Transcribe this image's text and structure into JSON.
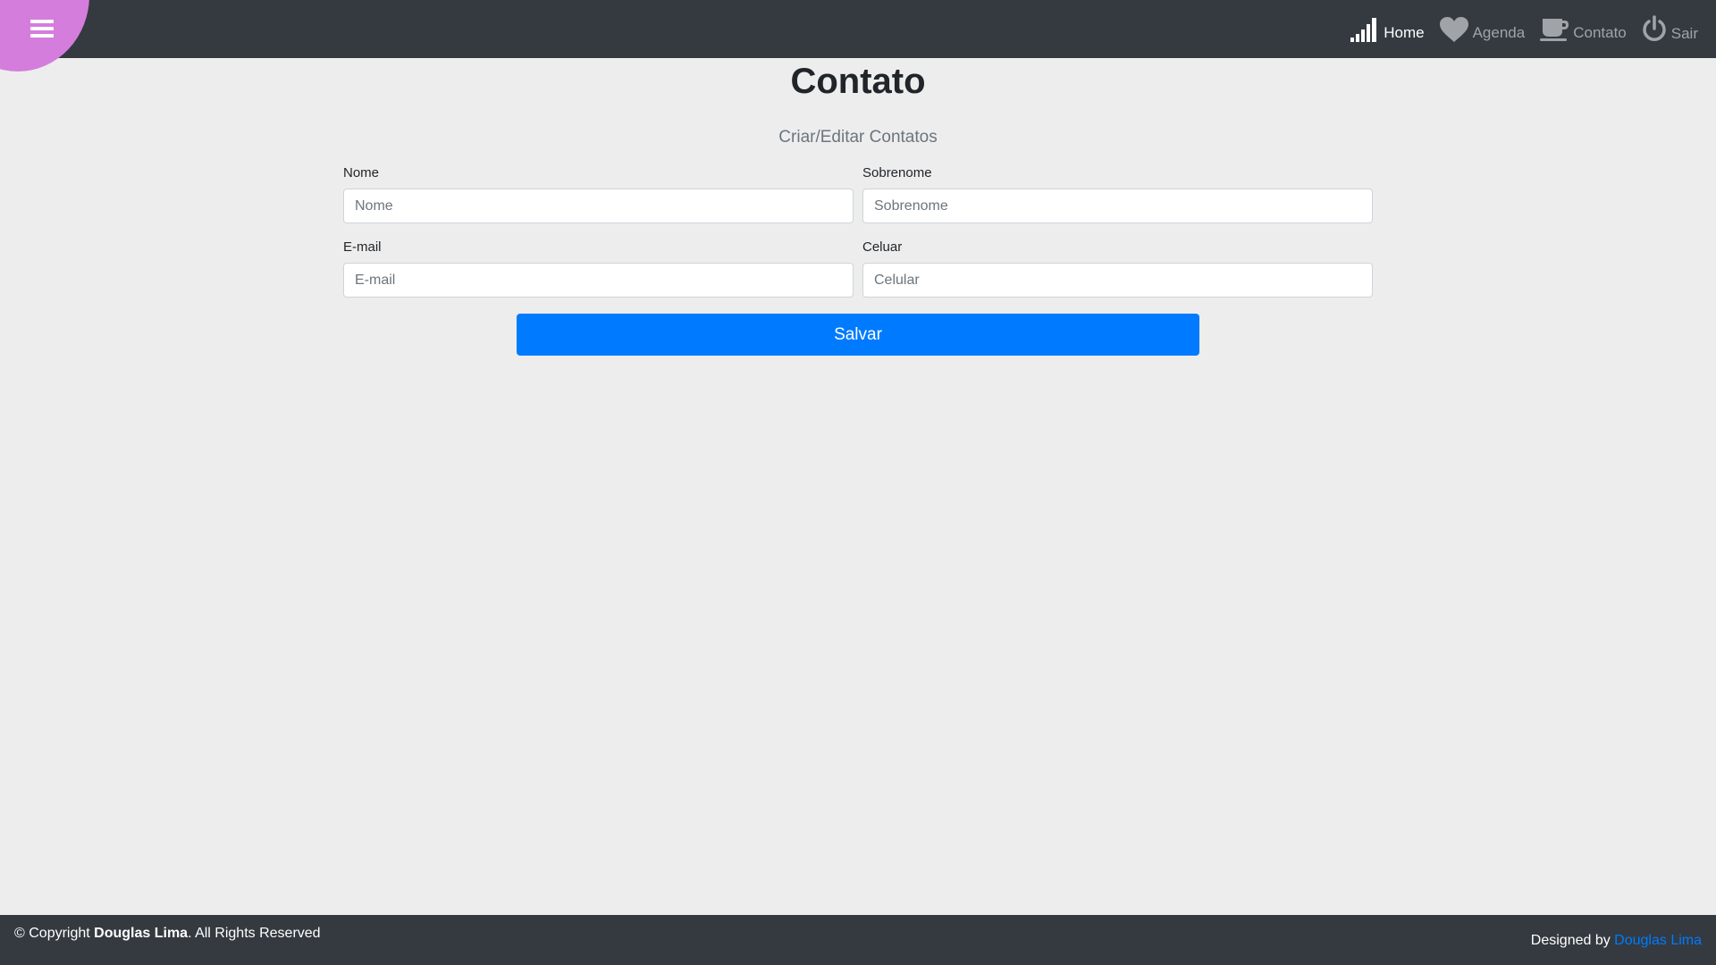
{
  "header": {
    "nav": [
      {
        "label": "Home",
        "icon": "signal-bars-icon",
        "active": true
      },
      {
        "label": "Agenda",
        "icon": "heart-icon",
        "active": false
      },
      {
        "label": "Contato",
        "icon": "coffee-cup-icon",
        "active": false
      },
      {
        "label": "Sair",
        "icon": "power-icon",
        "active": false
      }
    ],
    "menu_icon": "hamburger-menu-icon",
    "menu_color": "#d47ddc"
  },
  "main": {
    "title": "Contato",
    "subtitle": "Criar/Editar Contatos",
    "form": {
      "nome": {
        "label": "Nome",
        "placeholder": "Nome",
        "value": ""
      },
      "sobrenome": {
        "label": "Sobrenome",
        "placeholder": "Sobrenome",
        "value": ""
      },
      "email": {
        "label": "E-mail",
        "placeholder": "E-mail",
        "value": ""
      },
      "celular": {
        "label": "Celuar",
        "placeholder": "Celular",
        "value": ""
      },
      "save_label": "Salvar"
    }
  },
  "footer": {
    "copyright_prefix": "© Copyright ",
    "copyright_name": "Douglas Lima",
    "copyright_suffix": ". All Rights Reserved",
    "designed_by_prefix": "Designed by ",
    "designed_by_name": "Douglas Lima"
  },
  "colors": {
    "topbar": "#343a40",
    "background": "#ededed",
    "accent": "#007bff"
  }
}
